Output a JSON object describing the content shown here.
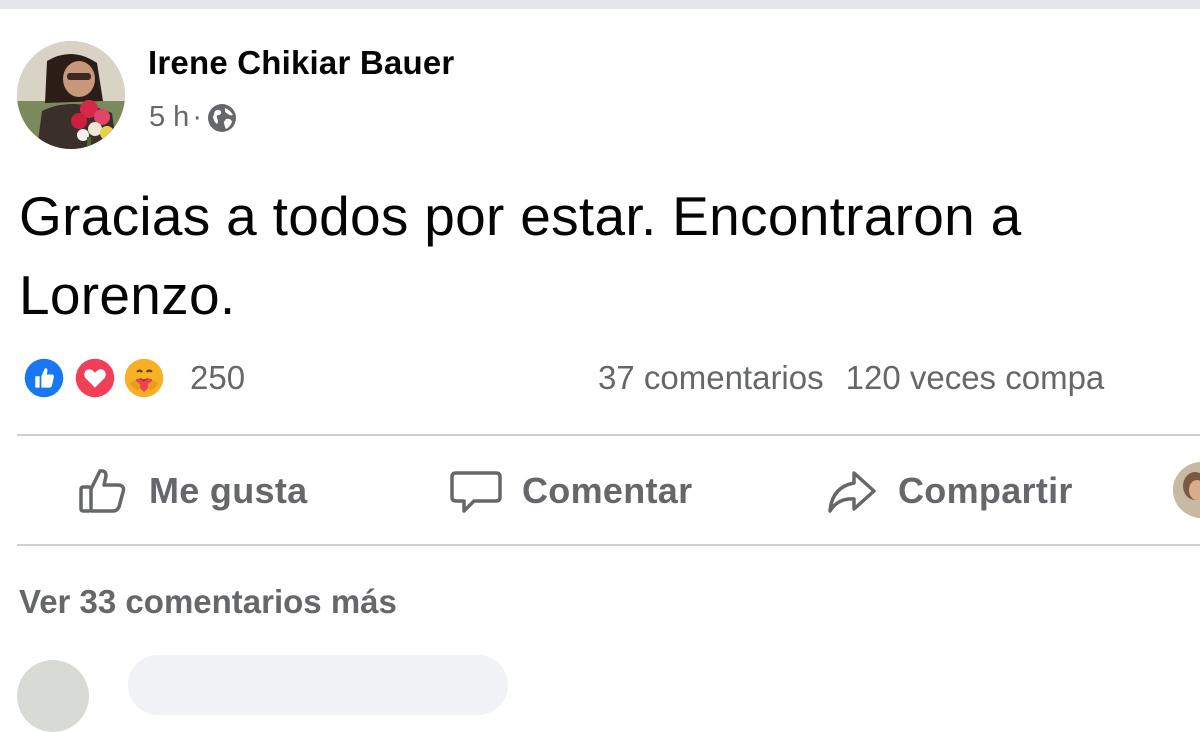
{
  "post": {
    "author": "Irene Chikiar Bauer",
    "time": "5 h",
    "separator": "·",
    "privacy_icon": "globe-icon",
    "text": "Gracias a todos por estar. Encontraron a Lorenzo."
  },
  "reactions": {
    "icons": [
      "like-reaction-icon",
      "love-reaction-icon",
      "care-reaction-icon"
    ],
    "count": "250",
    "comments": "37 comentarios",
    "shares": "120 veces compa"
  },
  "actions": {
    "like": "Me gusta",
    "comment": "Comentar",
    "share": "Compartir"
  },
  "comments": {
    "more": "Ver 33 comentarios más"
  },
  "colors": {
    "like_blue": "#1877f2",
    "love_red": "#f33e58",
    "care_yellow": "#f7b125",
    "secondary_text": "#65676b"
  }
}
